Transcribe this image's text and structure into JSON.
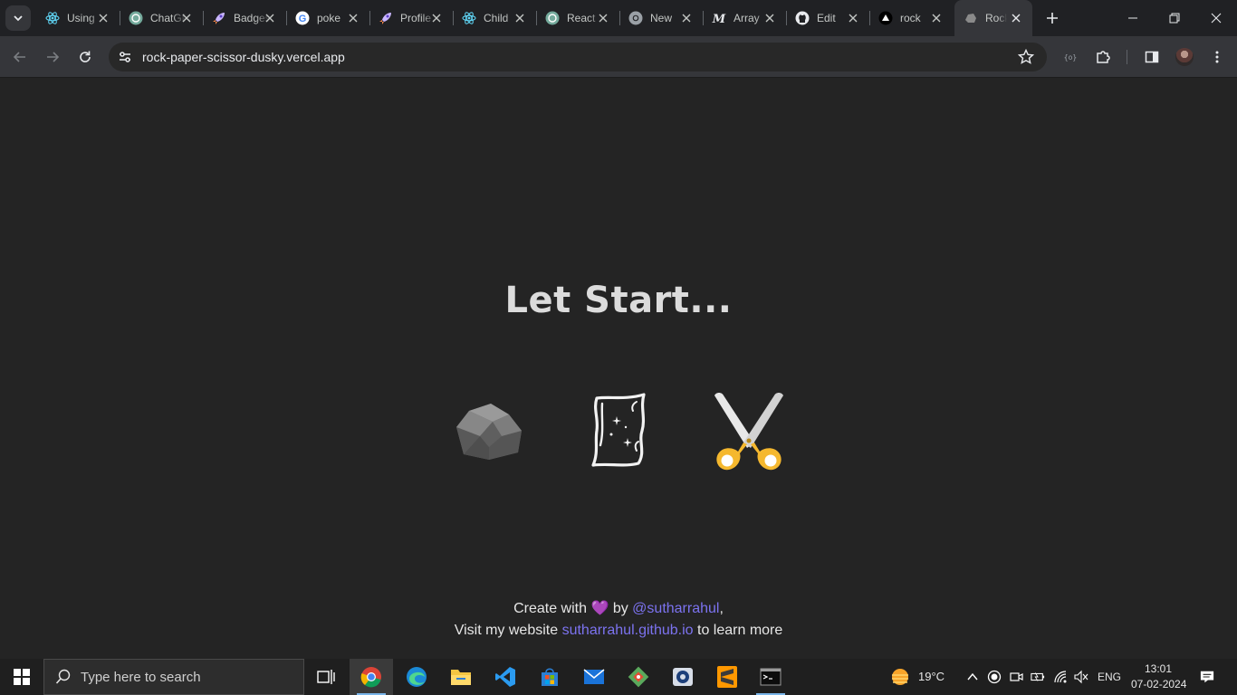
{
  "browser": {
    "tabs": [
      {
        "title": "Using",
        "icon": "react-icon"
      },
      {
        "title": "ChatGPT",
        "icon": "chatgpt-icon"
      },
      {
        "title": "Badges",
        "icon": "rocket-icon"
      },
      {
        "title": "poke",
        "icon": "google-icon"
      },
      {
        "title": "Profile",
        "icon": "rocket-icon"
      },
      {
        "title": "Child",
        "icon": "react-icon"
      },
      {
        "title": "React",
        "icon": "chatgpt-icon"
      },
      {
        "title": "New",
        "icon": "chrome-icon"
      },
      {
        "title": "Array",
        "icon": "medium-icon"
      },
      {
        "title": "Edit",
        "icon": "github-icon"
      },
      {
        "title": "rock",
        "icon": "vercel-icon"
      },
      {
        "title": "Rock",
        "icon": "rock-icon",
        "active": true
      }
    ],
    "url": "rock-paper-scissor-dusky.vercel.app"
  },
  "page": {
    "heading": "Let Start...",
    "choices": [
      {
        "name": "rock",
        "icon": "rock-icon"
      },
      {
        "name": "paper",
        "icon": "paper-icon"
      },
      {
        "name": "scissors",
        "icon": "scissors-icon"
      }
    ],
    "footer": {
      "line1_prefix": "Create with",
      "heart": "💜",
      "by": "by",
      "author": "@sutharrahul",
      "comma": ",",
      "line2_prefix": "Visit my website",
      "website": "sutharrahul.github.io",
      "line2_suffix": "to learn more"
    }
  },
  "taskbar": {
    "search_placeholder": "Type here to search",
    "weather": "19°C",
    "language": "ENG",
    "time": "13:01",
    "date": "07-02-2024",
    "apps": [
      "task-view",
      "chrome",
      "edge",
      "file-explorer",
      "vscode",
      "microsoft-store",
      "mail",
      "git",
      "obs",
      "sublime-text",
      "terminal"
    ]
  },
  "colors": {
    "page_bg": "#242424",
    "link": "#7c73f0",
    "heading": "#dcdcdc",
    "scissor_handle": "#f5b82e"
  }
}
